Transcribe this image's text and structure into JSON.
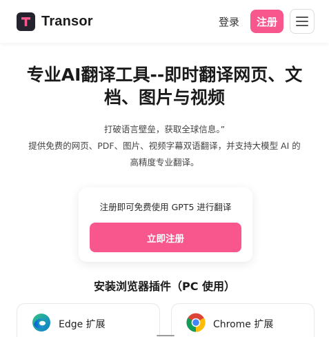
{
  "header": {
    "brand_name": "Transor",
    "logo_letter": "T",
    "login_label": "登录",
    "register_label": "注册"
  },
  "hero": {
    "title": "专业AI翻译工具--即时翻译网页、文档、图片与视频",
    "desc_line1": "打破语言壁垒，获取全球信息。”",
    "desc_line2": "提供免费的网页、PDF、图片、视频字幕双语翻译，并支持大模型 AI 的",
    "desc_line3": "高精度专业翻译。"
  },
  "cta": {
    "text": "注册即可免费使用 GPT5 进行翻译",
    "button_label": "立即注册"
  },
  "extensions": {
    "heading": "安装浏览器插件（PC 使用）",
    "items": [
      {
        "label": "Edge 扩展",
        "icon": "edge-icon"
      },
      {
        "label": "Chrome 扩展",
        "icon": "chrome-icon"
      }
    ]
  },
  "colors": {
    "accent": "#f7578c",
    "logo_bg": "#24232e",
    "logo_letter": "#f7578c"
  }
}
